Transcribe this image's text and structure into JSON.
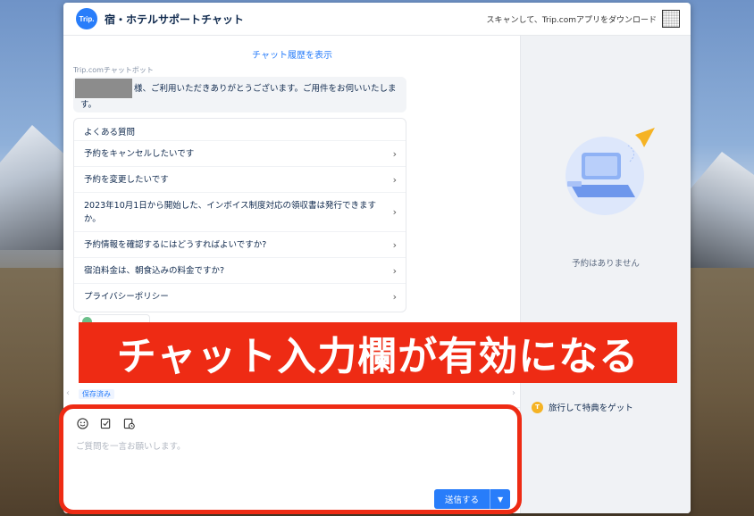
{
  "header": {
    "logo_text": "Trip.",
    "title": "宿・ホテルサポートチャット",
    "download_text": "スキャンして、Trip.comアプリをダウンロード"
  },
  "chat": {
    "history_link": "チャット履歴を表示",
    "bot_name": "Trip.comチャットボット",
    "greeting": "様、ご利用いただきありがとうございます。ご用件をお伺いいたします。",
    "faq_title": "よくある質問",
    "faq_items": [
      "予約をキャンセルしたいです",
      "予約を変更したいです",
      "2023年10月1日から開始した、インボイス制度対応の領収書は発行できますか。",
      "予約情報を確認するにはどうすればよいですか?",
      "宿泊料金は、朝食込みの料金ですか?",
      "プライバシーポリシー"
    ],
    "saved_tag": "保存済み"
  },
  "input": {
    "placeholder": "ご質問を一言お願いします。",
    "send_label": "送信する"
  },
  "sidebar": {
    "no_reservations": "予約はありません",
    "reward_text": "旅行して特典をゲット"
  },
  "overlay": {
    "banner_text": "チャット入力欄が有効になる"
  },
  "colors": {
    "accent": "#287dfa",
    "annotation_red": "#ee2b14",
    "coin": "#f5b324"
  },
  "icons": [
    "emoji-icon",
    "edit-order-icon",
    "history-order-icon",
    "chevron-right-icon",
    "paper-plane-icon",
    "laptop-illustration"
  ]
}
